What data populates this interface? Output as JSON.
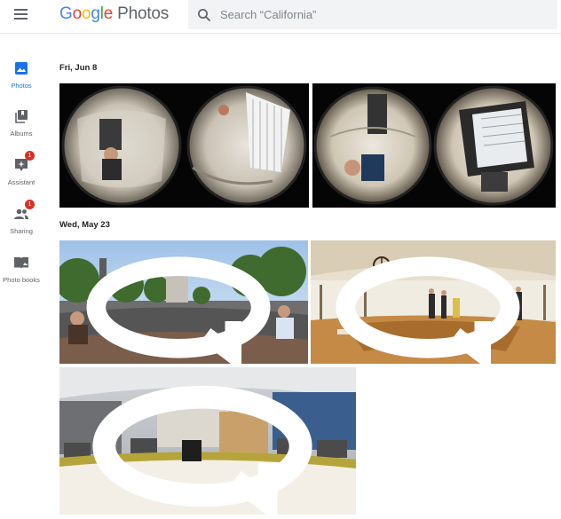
{
  "header": {
    "logo_google": [
      "G",
      "o",
      "o",
      "g",
      "l",
      "e"
    ],
    "logo_product": "Photos",
    "search_placeholder": "Search “California”"
  },
  "sidebar": {
    "items": [
      {
        "label": "Photos",
        "icon": "photos-icon",
        "active": true
      },
      {
        "label": "Albums",
        "icon": "albums-icon",
        "active": false
      },
      {
        "label": "Assistant",
        "icon": "assistant-icon",
        "active": false,
        "badge": "1"
      },
      {
        "label": "Sharing",
        "icon": "sharing-icon",
        "active": false,
        "badge": "1"
      },
      {
        "label": "Photo books",
        "icon": "photo-books-icon",
        "active": false
      }
    ]
  },
  "main": {
    "sections": [
      {
        "date": "Fri, Jun 8"
      },
      {
        "date": "Wed, May 23"
      }
    ]
  },
  "colors": {
    "accent": "#1a73e8",
    "badge": "#d93025",
    "search_bg": "#f1f3f4"
  }
}
